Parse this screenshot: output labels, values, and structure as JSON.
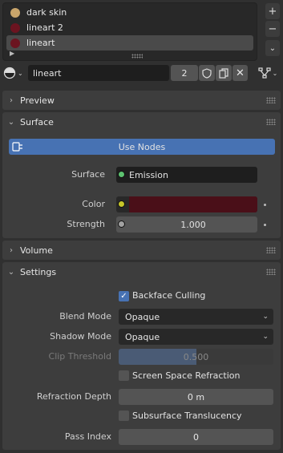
{
  "slots": [
    {
      "label": "dark skin",
      "color": "#c9a56b"
    },
    {
      "label": "lineart 2",
      "color": "#6b1420"
    },
    {
      "label": "lineart",
      "color": "#6b1420",
      "active": true
    }
  ],
  "slot_buttons": {
    "add": "+",
    "remove": "−",
    "specials": "⌄"
  },
  "id_row": {
    "material_name": "lineart",
    "users": "2",
    "fake_user_icon": "shield-icon",
    "duplicate_icon": "copy-icon",
    "unlink_icon": "close-icon"
  },
  "panels": {
    "preview": "Preview",
    "surface": "Surface",
    "volume": "Volume",
    "settings": "Settings"
  },
  "surface": {
    "use_nodes": "Use Nodes",
    "surface_label": "Surface",
    "surface_value": "Emission",
    "color_label": "Color",
    "color_value": "#4a0f18",
    "strength_label": "Strength",
    "strength_value": "1.000"
  },
  "settings": {
    "backface_culling": "Backface Culling",
    "backface_culling_checked": true,
    "blend_mode_label": "Blend Mode",
    "blend_mode_value": "Opaque",
    "shadow_mode_label": "Shadow Mode",
    "shadow_mode_value": "Opaque",
    "clip_threshold_label": "Clip Threshold",
    "clip_threshold_value": "0.500",
    "clip_threshold_fraction": 0.5,
    "ssr": "Screen Space Refraction",
    "refraction_depth_label": "Refraction Depth",
    "refraction_depth_value": "0 m",
    "subsurface": "Subsurface Translucency",
    "pass_index_label": "Pass Index",
    "pass_index_value": "0"
  },
  "colors": {
    "accent": "#4772b3",
    "emission_socket": "#5dc270",
    "color_socket": "#c7c729"
  }
}
